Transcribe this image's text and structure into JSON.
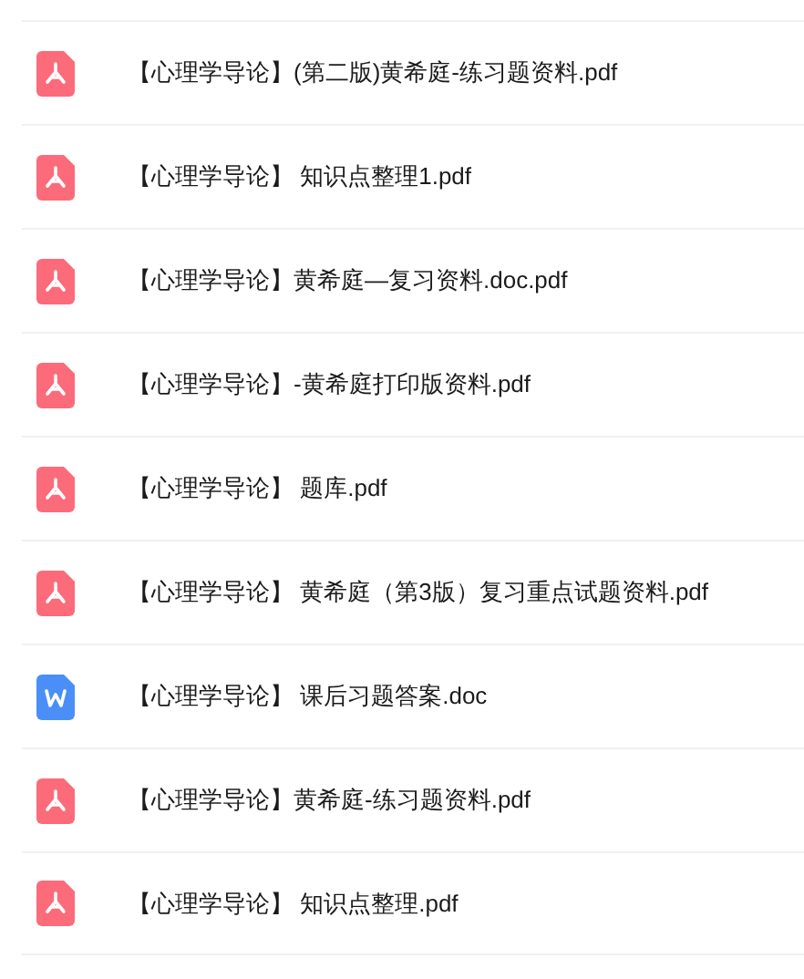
{
  "files": [
    {
      "kind": "pdf",
      "name": "【心理学导论】(第二版)黄希庭-练习题资料.pdf"
    },
    {
      "kind": "pdf",
      "name": "【心理学导论】 知识点整理1.pdf"
    },
    {
      "kind": "pdf",
      "name": "【心理学导论】黄希庭—复习资料.doc.pdf"
    },
    {
      "kind": "pdf",
      "name": "【心理学导论】-黄希庭打印版资料.pdf"
    },
    {
      "kind": "pdf",
      "name": "【心理学导论】 题库.pdf"
    },
    {
      "kind": "pdf",
      "name": "【心理学导论】 黄希庭（第3版）复习重点试题资料.pdf"
    },
    {
      "kind": "doc",
      "name": "【心理学导论】 课后习题答案.doc"
    },
    {
      "kind": "pdf",
      "name": "【心理学导论】黄希庭-练习题资料.pdf"
    },
    {
      "kind": "pdf",
      "name": "【心理学导论】 知识点整理.pdf"
    }
  ]
}
